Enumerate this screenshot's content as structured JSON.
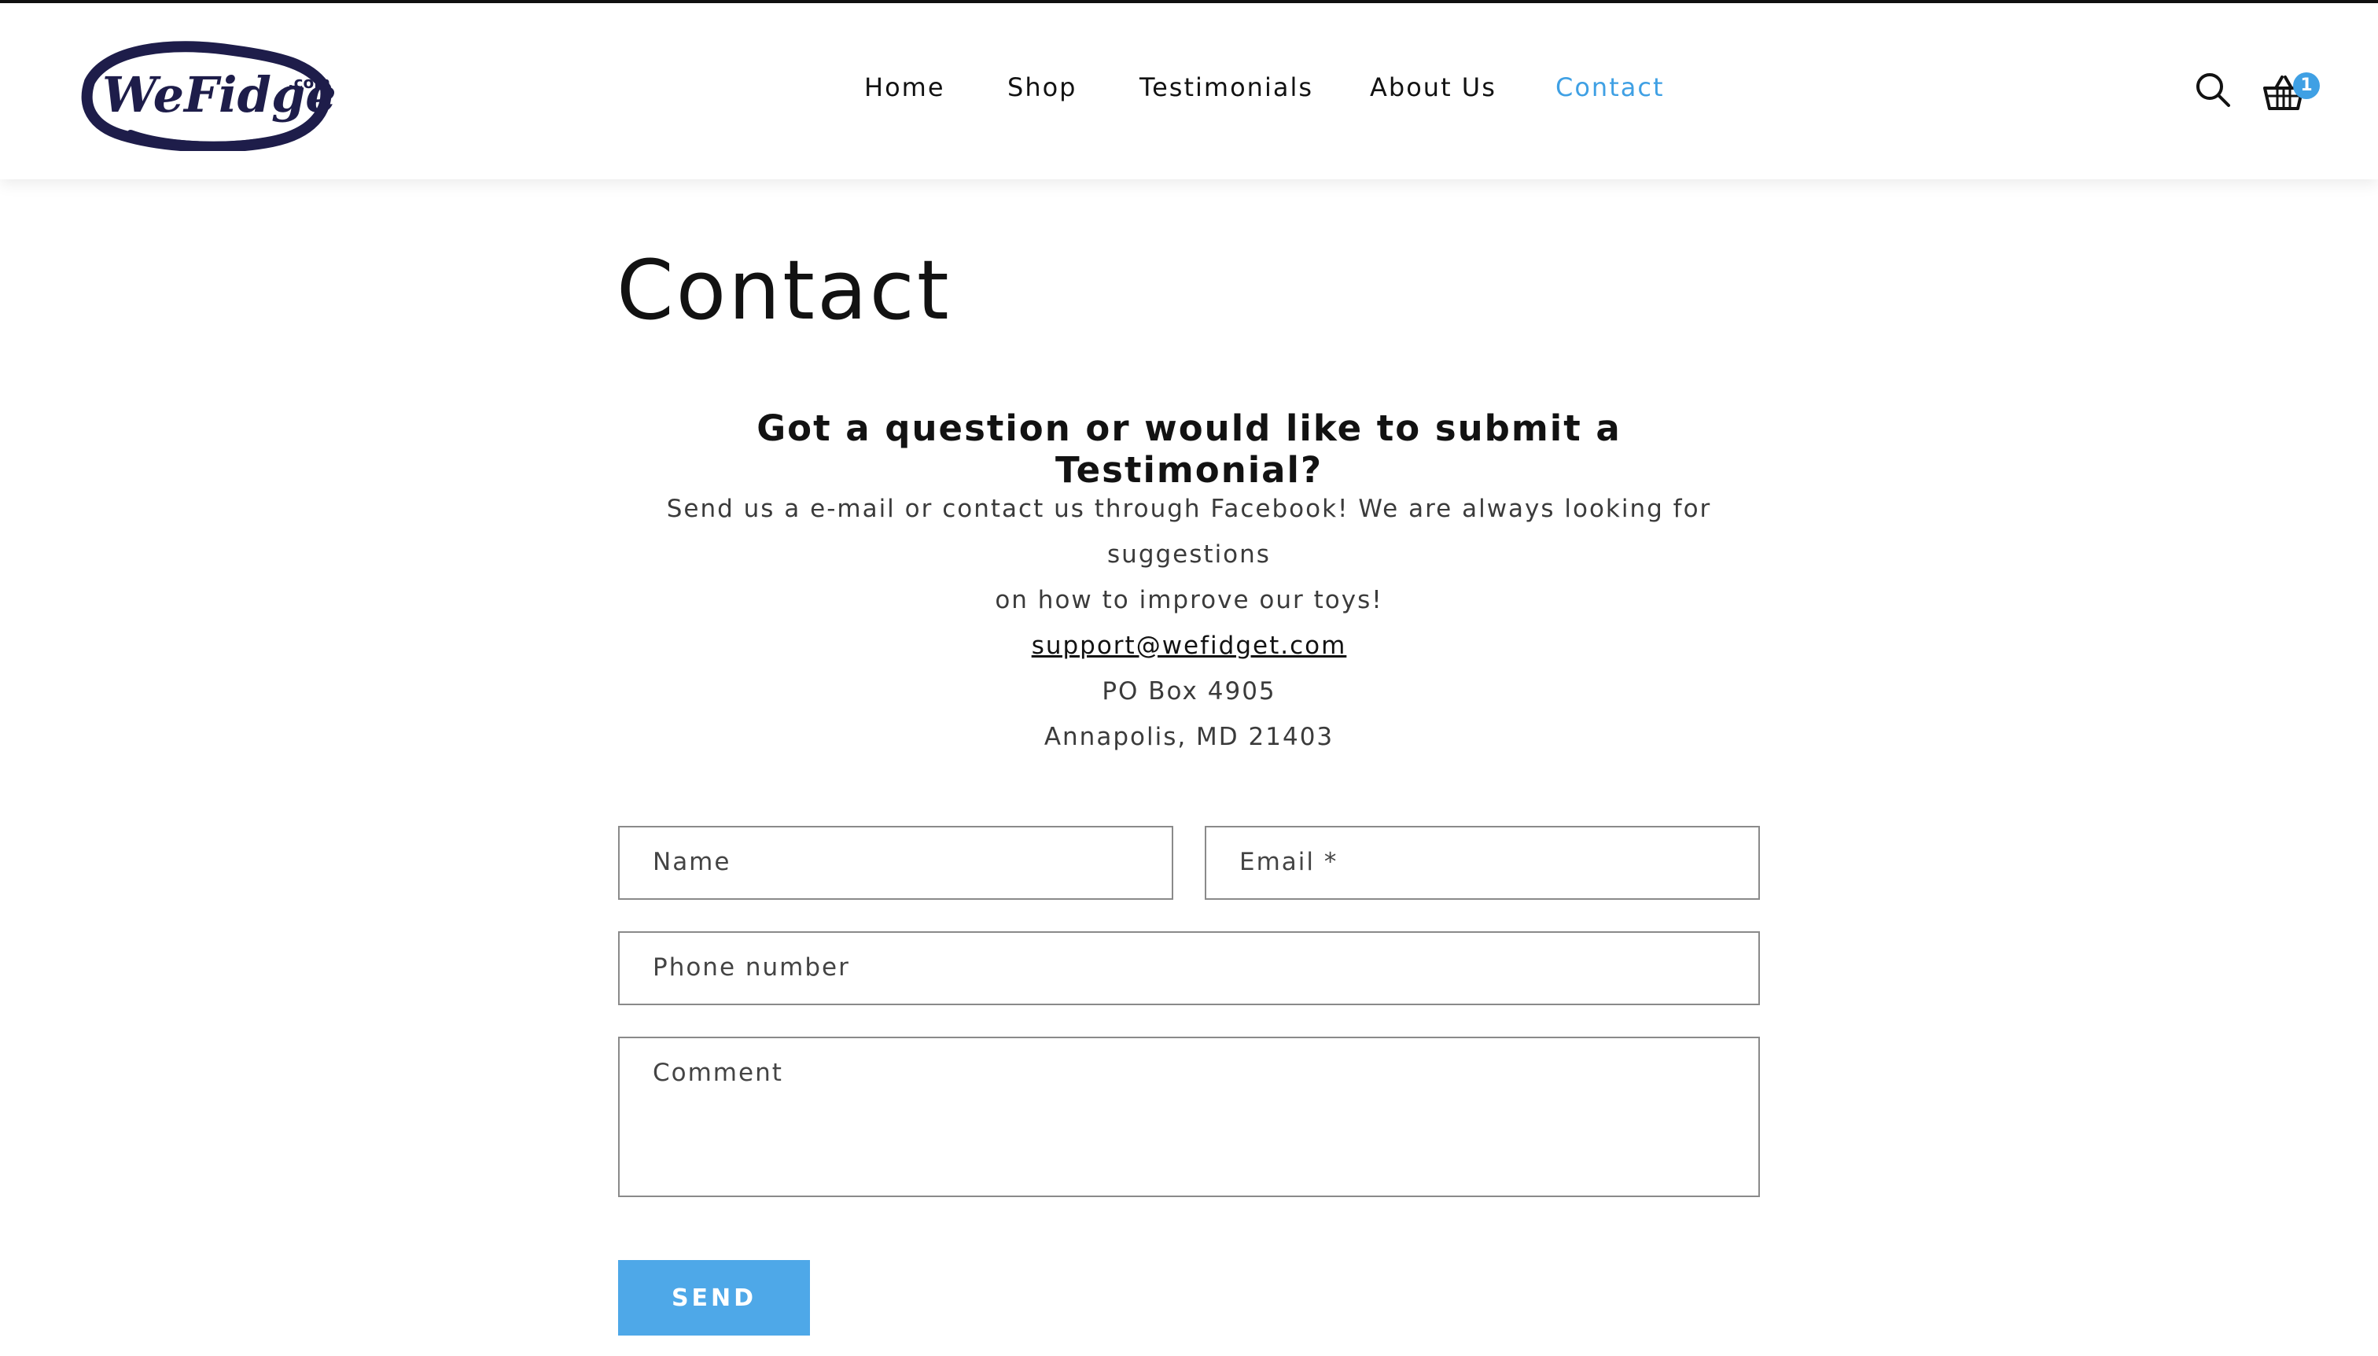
{
  "brand": {
    "logo_text": "WeFidget",
    "logo_suffix": ".com"
  },
  "nav": {
    "items": [
      {
        "label": "Home",
        "active": false
      },
      {
        "label": "Shop",
        "active": false
      },
      {
        "label": "Testimonials",
        "active": false
      },
      {
        "label": "About Us",
        "active": false
      },
      {
        "label": "Contact",
        "active": true
      }
    ]
  },
  "header_icons": {
    "search_icon": "search-icon",
    "cart_icon": "basket-icon",
    "cart_count": "1"
  },
  "page": {
    "title": "Contact",
    "subheading": "Got a question or would like to submit a Testimonial?",
    "intro_line1": "Send us a e-mail or contact us through Facebook! We are always looking for suggestions",
    "intro_line2": "on how to improve our toys!",
    "email": "support@wefidget.com",
    "address_line1": "PO Box 4905",
    "address_line2": "Annapolis, MD 21403"
  },
  "form": {
    "name_placeholder": "Name",
    "email_placeholder": "Email *",
    "phone_placeholder": "Phone number",
    "comment_placeholder": "Comment",
    "submit_label": "SEND"
  },
  "colors": {
    "accent": "#3fa0e4",
    "button": "#4ea8e8",
    "text": "#121212",
    "logo_navy": "#1e1d4a"
  }
}
